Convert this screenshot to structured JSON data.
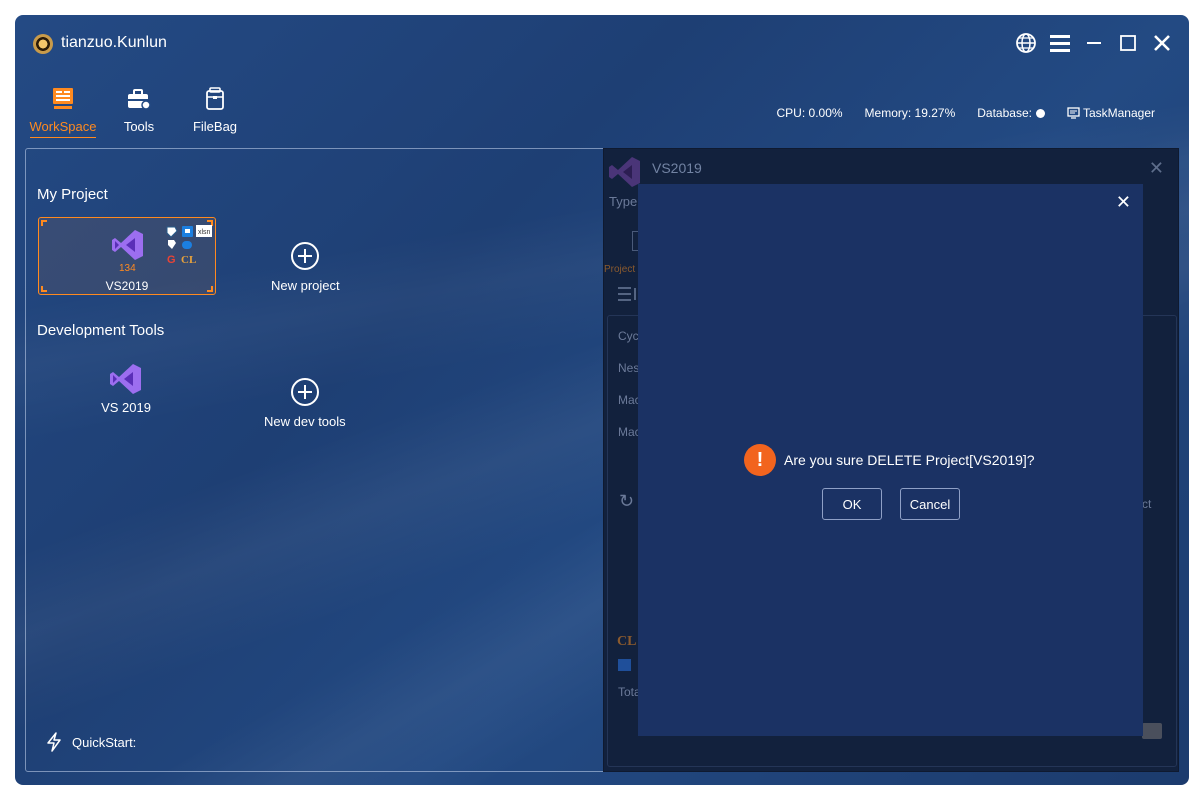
{
  "app": {
    "title": "tianzuo.Kunlun"
  },
  "window_controls": [
    "globe-icon",
    "menu-icon",
    "minimize-icon",
    "maximize-icon",
    "close-icon"
  ],
  "nav": {
    "items": [
      {
        "label": "WorkSpace",
        "icon": "workspace-icon",
        "active": true
      },
      {
        "label": "Tools",
        "icon": "toolbox-icon",
        "active": false
      },
      {
        "label": "FileBag",
        "icon": "filebag-icon",
        "active": false
      }
    ]
  },
  "status": {
    "cpu": "CPU: 0.00%",
    "memory": "Memory: 19.27%",
    "database": "Database:",
    "task_manager": "TaskManager"
  },
  "workspace": {
    "my_project_title": "My Project",
    "project": {
      "name": "VS2019",
      "count": "134"
    },
    "new_project": "New project",
    "dev_tools_title": "Development Tools",
    "dev_tool": {
      "name": "VS 2019"
    },
    "new_dev_tools": "New dev tools",
    "quickstart": "QuickStart:"
  },
  "detail_panel": {
    "title": "VS2019",
    "type_label": "Type:",
    "project_tab": "Project",
    "rows": [
      "Cyc",
      "Nes",
      "Mac",
      "Mac"
    ],
    "ct_fragment": "ct",
    "tota_fragment": "Tota",
    "cl_label": "CL"
  },
  "dialog": {
    "message": "Are you sure DELETE Project[VS2019]?",
    "ok": "OK",
    "cancel": "Cancel"
  },
  "colors": {
    "accent": "#ff8a1f",
    "background": "#234a83",
    "dialog": "#1b3264",
    "warning": "#f2641e"
  }
}
